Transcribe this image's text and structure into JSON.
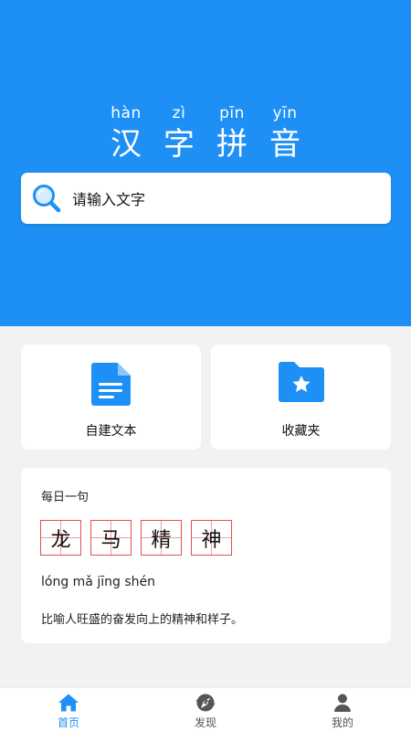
{
  "header": {
    "pinyin": [
      "hàn",
      "zì",
      "pīn",
      "yīn"
    ],
    "title_chars": [
      "汉",
      "字",
      "拼",
      "音"
    ]
  },
  "search": {
    "placeholder": "请输入文字",
    "icon": "search-icon"
  },
  "tiles": [
    {
      "label": "自建文本",
      "icon": "document-icon"
    },
    {
      "label": "收藏夹",
      "icon": "star-folder-icon"
    }
  ],
  "daily": {
    "title": "每日一句",
    "chars": [
      "龙",
      "马",
      "精",
      "神"
    ],
    "pinyin": "lóng mǎ jīng shén",
    "meaning": "比喻人旺盛的奋发向上的精神和样子。"
  },
  "tabbar": {
    "items": [
      {
        "label": "首页",
        "icon": "home-icon",
        "active": true
      },
      {
        "label": "发现",
        "icon": "discover-icon",
        "active": false
      },
      {
        "label": "我的",
        "icon": "user-icon",
        "active": false
      }
    ]
  },
  "colors": {
    "primary": "#1e90f5",
    "grid": "#e05050",
    "background": "#f2f2f4"
  }
}
